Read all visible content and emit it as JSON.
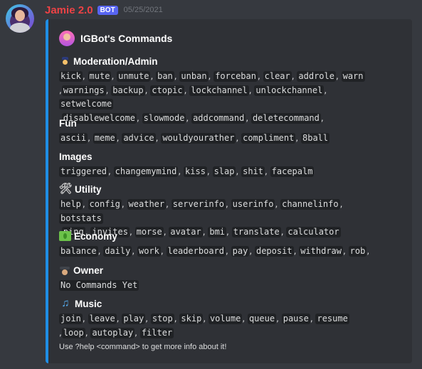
{
  "message": {
    "author": "Jamie 2.0",
    "bot_tag": "BOT",
    "timestamp": "05/25/2021"
  },
  "embed": {
    "accent_color": "#1f8ee6",
    "author_name": "IGBot's Commands",
    "fields": [
      {
        "name": "Moderation/Admin",
        "icon": "police-officer-icon",
        "lines": [
          [
            "kick",
            "mute",
            "unmute",
            "ban",
            "unban",
            "forceban",
            "clear",
            "addrole",
            "warn"
          ],
          [
            "warnings",
            "backup",
            "ctopic",
            "lockchannel",
            "unlockchannel",
            "setwelcome"
          ],
          [
            "disablewelcome",
            "slowmode",
            "addcommand",
            "deletecommand"
          ]
        ]
      },
      {
        "name": "Fun",
        "icon": "",
        "lines": [
          [
            "ascii",
            "meme",
            "advice",
            "wouldyourather",
            "compliment",
            "8ball"
          ]
        ]
      },
      {
        "name": "Images",
        "icon": "",
        "lines": [
          [
            "triggered",
            "changemymind",
            "kiss",
            "slap",
            "shit",
            "facepalm"
          ]
        ]
      },
      {
        "name": "Utility",
        "icon": "hammer-and-wrench-icon",
        "lines": [
          [
            "help",
            "config",
            "weather",
            "serverinfo",
            "userinfo",
            "channelinfo",
            "botstats"
          ],
          [
            "ping",
            "invites",
            "morse",
            "avatar",
            "bmi",
            "translate",
            "calculator"
          ]
        ]
      },
      {
        "name": "Economy",
        "icon": "money-with-wings-icon",
        "lines": [
          [
            "balance",
            "daily",
            "work",
            "leaderboard",
            "pay",
            "deposit",
            "withdraw",
            "rob"
          ]
        ]
      },
      {
        "name": "Owner",
        "icon": "detective-icon",
        "lines": [
          [
            "No Commands Yet"
          ]
        ]
      },
      {
        "name": "Music",
        "icon": "musical-note-icon",
        "lines": [
          [
            "join",
            "leave",
            "play",
            "stop",
            "skip",
            "volume",
            "queue",
            "pause",
            "resume"
          ],
          [
            "loop",
            "autoplay",
            "filter"
          ]
        ]
      }
    ],
    "footer_text": "Use ?help <command> to get more info about it!"
  }
}
